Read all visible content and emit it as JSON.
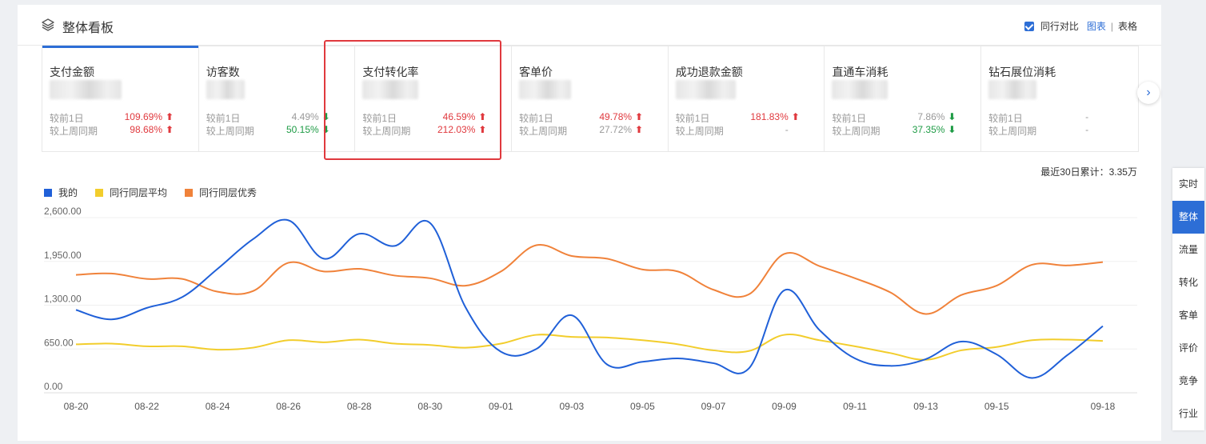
{
  "header": {
    "title": "整体看板",
    "compare_label": "同行对比",
    "view_chart": "图表",
    "view_sep": "|",
    "view_table": "表格"
  },
  "cards": [
    {
      "name": "支付金额",
      "r1_label": "较前1日",
      "r1_value": "109.69%",
      "r1_dir": "up",
      "r2_label": "较上周同期",
      "r2_value": "98.68%",
      "r2_dir": "up"
    },
    {
      "name": "访客数",
      "r1_label": "较前1日",
      "r1_value": "4.49%",
      "r1_dir": "down",
      "r2_label": "较上周同期",
      "r2_value": "50.15%",
      "r2_dir": "down"
    },
    {
      "name": "支付转化率",
      "r1_label": "较前1日",
      "r1_value": "46.59%",
      "r1_dir": "up",
      "r2_label": "较上周同期",
      "r2_value": "212.03%",
      "r2_dir": "up"
    },
    {
      "name": "客单价",
      "r1_label": "较前1日",
      "r1_value": "49.78%",
      "r1_dir": "up",
      "r2_label": "较上周同期",
      "r2_value": "27.72%",
      "r2_dir": "up"
    },
    {
      "name": "成功退款金额",
      "r1_label": "较前1日",
      "r1_value": "181.83%",
      "r1_dir": "up",
      "r2_label": "较上周同期",
      "r2_value": "-",
      "r2_dir": "none"
    },
    {
      "name": "直通车消耗",
      "r1_label": "较前1日",
      "r1_value": "7.86%",
      "r1_dir": "down",
      "r2_label": "较上周同期",
      "r2_value": "37.35%",
      "r2_dir": "down"
    },
    {
      "name": "钻石展位消耗",
      "r1_label": "较前1日",
      "r1_value": "-",
      "r1_dir": "none",
      "r2_label": "较上周同期",
      "r2_value": "-",
      "r2_dir": "none"
    }
  ],
  "cumulative": "最近30日累计：3.35万",
  "legend": [
    "我的",
    "同行同层平均",
    "同行同层优秀"
  ],
  "colors": {
    "mine": "#2060d8",
    "avg": "#f2cd2c",
    "excellent": "#f0823a",
    "accent": "#2d6ed6",
    "up": "#e0393e",
    "down": "#1e9b45"
  },
  "side_tabs": [
    "实时",
    "整体",
    "流量",
    "转化",
    "客单",
    "评价",
    "竞争",
    "行业"
  ],
  "chart_data": {
    "type": "line",
    "ylim": [
      0,
      2600
    ],
    "y_ticks": [
      "2,600.00",
      "1,950.00",
      "1,300.00",
      "650.00",
      "0.00"
    ],
    "x_tick_labels": [
      "08-20",
      "08-22",
      "08-24",
      "08-26",
      "08-28",
      "08-30",
      "09-01",
      "09-03",
      "09-05",
      "09-07",
      "09-09",
      "09-11",
      "09-13",
      "09-15",
      "09-18"
    ],
    "x": [
      "08-20",
      "08-21",
      "08-22",
      "08-23",
      "08-24",
      "08-25",
      "08-26",
      "08-27",
      "08-28",
      "08-29",
      "08-30",
      "08-31",
      "09-01",
      "09-02",
      "09-03",
      "09-04",
      "09-05",
      "09-06",
      "09-07",
      "09-08",
      "09-09",
      "09-10",
      "09-11",
      "09-12",
      "09-13",
      "09-14",
      "09-15",
      "09-16",
      "09-17",
      "09-18"
    ],
    "series": [
      {
        "name": "我的",
        "values": [
          1230,
          1090,
          1260,
          1420,
          1840,
          2280,
          2560,
          1990,
          2360,
          2180,
          2520,
          1270,
          610,
          650,
          1150,
          420,
          460,
          510,
          440,
          360,
          1520,
          930,
          510,
          400,
          500,
          760,
          570,
          220,
          560,
          990
        ]
      },
      {
        "name": "同行同层平均",
        "values": [
          720,
          730,
          690,
          690,
          640,
          670,
          780,
          750,
          790,
          730,
          710,
          670,
          730,
          860,
          830,
          820,
          780,
          720,
          630,
          620,
          860,
          780,
          690,
          590,
          490,
          630,
          680,
          780,
          790,
          770
        ]
      },
      {
        "name": "同行同层优秀",
        "values": [
          1750,
          1770,
          1690,
          1690,
          1500,
          1510,
          1930,
          1800,
          1840,
          1740,
          1700,
          1590,
          1800,
          2190,
          2030,
          1990,
          1830,
          1800,
          1530,
          1460,
          2060,
          1880,
          1700,
          1490,
          1170,
          1450,
          1590,
          1900,
          1890,
          1940
        ]
      }
    ]
  }
}
